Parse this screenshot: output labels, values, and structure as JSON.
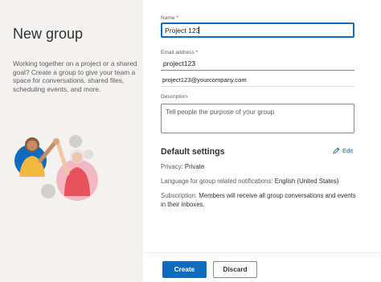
{
  "left": {
    "title": "New group",
    "description": "Working together on a project or a shared goal? Create a group to give your team a space for conversations, shared files, scheduling events, and more."
  },
  "form": {
    "name_label": "Name *",
    "name_value": "Project 123",
    "email_label": "Email address *",
    "email_value": "project123",
    "email_full": "project123@yourcompany.com",
    "description_label": "Description",
    "description_placeholder": "Tell people the purpose of your group"
  },
  "settings": {
    "title": "Default settings",
    "edit_label": "Edit",
    "privacy_label": "Privacy:",
    "privacy_value": "Private",
    "language_label": "Language for group related notifications:",
    "language_value": "English (United States)",
    "subscription_label": "Subscription:",
    "subscription_value": "Members will receive all group conversations and events in their inboxes."
  },
  "footer": {
    "create_label": "Create",
    "discard_label": "Discard"
  },
  "colors": {
    "accent": "#0f6cbd",
    "left_pane_bg": "#f3f2f1"
  },
  "icons": {
    "edit": "pencil-icon",
    "illustration": "people-high-five-illustration"
  }
}
